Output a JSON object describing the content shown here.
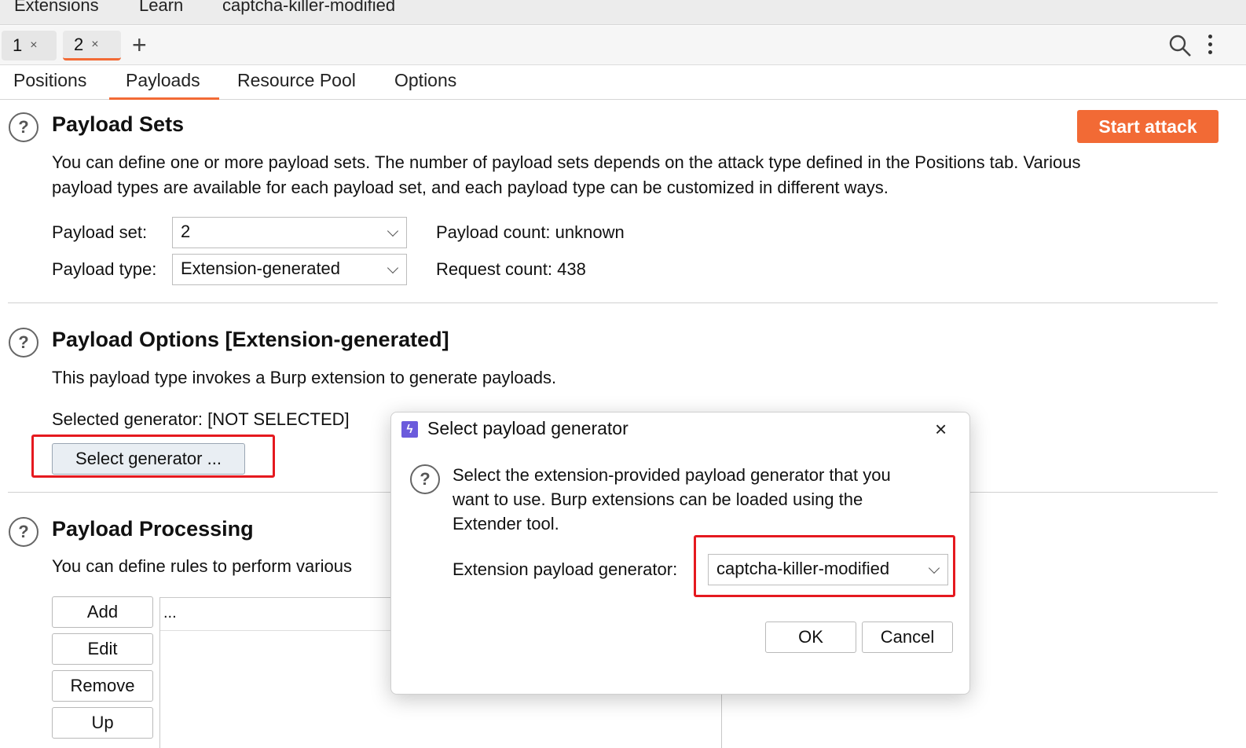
{
  "menubar": {
    "items": [
      "Extensions",
      "Learn",
      "captcha-killer-modified"
    ]
  },
  "tabs": [
    {
      "label": "1",
      "close": "×"
    },
    {
      "label": "2",
      "close": "×"
    }
  ],
  "tabs_add": "+",
  "subtabs": [
    "Positions",
    "Payloads",
    "Resource Pool",
    "Options"
  ],
  "payload_sets": {
    "title": "Payload Sets",
    "description_line1": "You can define one or more payload sets. The number of payload sets depends on the attack type defined in the Positions tab. Various",
    "description_line2": "payload types are available for each payload set, and each payload type can be customized in different ways.",
    "set_label": "Payload set:",
    "set_value": "2",
    "type_label": "Payload type:",
    "type_value": "Extension-generated",
    "count_text": "Payload count: unknown",
    "request_text": "Request count: 438",
    "start_label": "Start attack",
    "start_color": "#f26a35"
  },
  "payload_options": {
    "title": "Payload Options [Extension-generated]",
    "description": "This payload type invokes a Burp extension to generate payloads.",
    "selected_text": "Selected generator: [NOT SELECTED]",
    "select_button": "Select generator ..."
  },
  "payload_processing": {
    "title": "Payload Processing",
    "description": "You can define rules to perform various",
    "buttons": [
      "Add",
      "Edit",
      "Remove",
      "Up"
    ],
    "list_header": "..."
  },
  "dialog": {
    "title": "Select payload generator",
    "close": "×",
    "message_line1": "Select the extension-provided payload generator that you",
    "message_line2": "want to use. Burp extensions can be loaded using the",
    "message_line3": "Extender tool.",
    "generator_label": "Extension payload generator:",
    "generator_value": "captcha-killer-modified",
    "ok_label": "OK",
    "cancel_label": "Cancel"
  },
  "help_glyph": "?",
  "highlight_color": "#e5191f"
}
